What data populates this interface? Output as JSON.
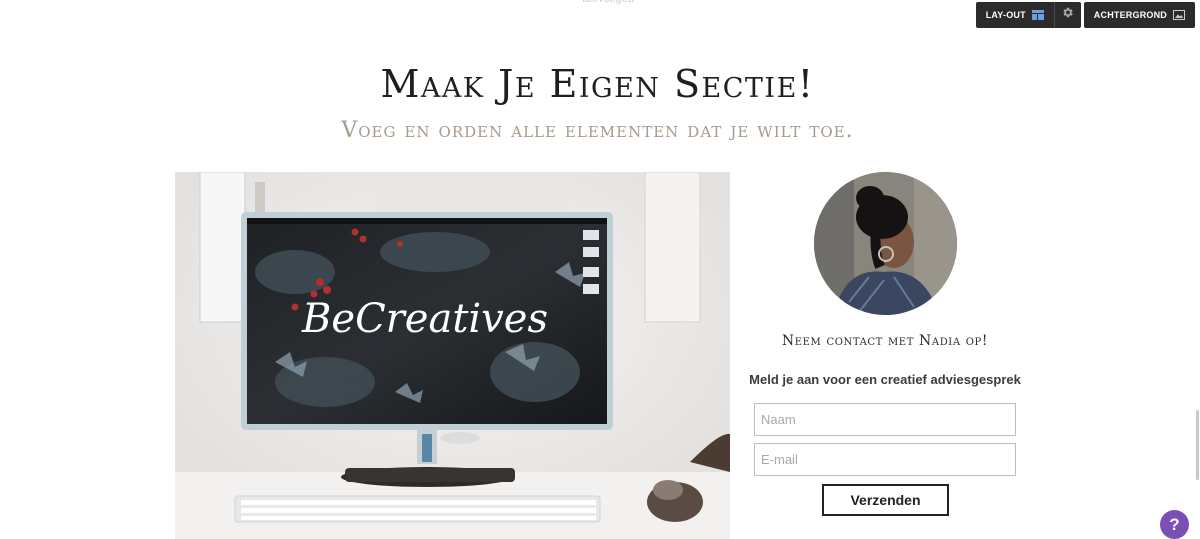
{
  "top_hint": "toevoegen",
  "toolbar": {
    "layout_label": "LAY-OUT",
    "background_label": "ACHTERGROND",
    "layout_icon": "layout-icon",
    "settings_icon": "gear-icon",
    "background_icon": "image-icon"
  },
  "section": {
    "title": "Maak Je Eigen Sectie!",
    "subtitle": "Voeg en orden alle elementen dat je wilt toe."
  },
  "hero": {
    "screen_text": "BeCreatives"
  },
  "contact": {
    "name_line": "Neem contact met Nadia op!",
    "prompt": "Meld je aan voor een creatief adviesgesprek",
    "name_placeholder": "Naam",
    "email_placeholder": "E-mail",
    "submit_label": "Verzenden"
  },
  "help": {
    "label": "?",
    "color": "#7b4fb3"
  }
}
